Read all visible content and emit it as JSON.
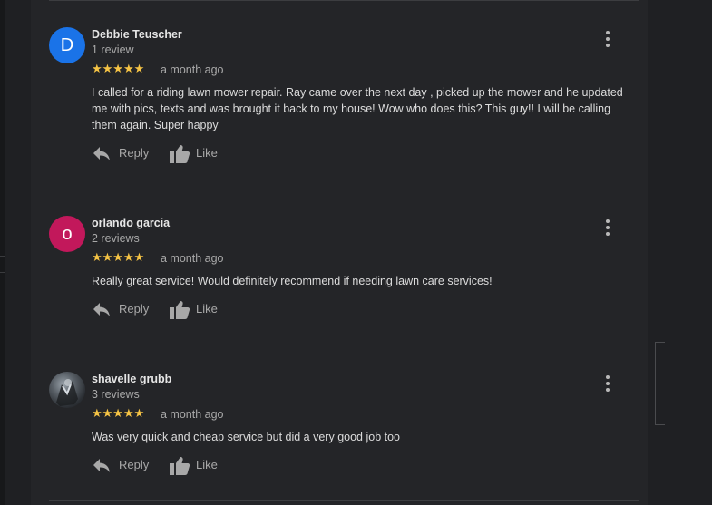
{
  "reviews": [
    {
      "avatar_letter": "D",
      "avatar_color": "#1a73e8",
      "name": "Debbie Teuscher",
      "review_count": "1 review",
      "stars": "★★★★★",
      "date": "a month ago",
      "text": "I called for a riding lawn mower repair. Ray came over the next day , picked up the mower and he updated me with pics, texts and was brought it back to my house! Wow who does this? This guy!! I will be calling them again. Super happy",
      "reply_label": "Reply",
      "like_label": "Like"
    },
    {
      "avatar_letter": "o",
      "avatar_color": "#c2185b",
      "name": "orlando garcia",
      "review_count": "2 reviews",
      "stars": "★★★★★",
      "date": "a month ago",
      "text": "Really great service! Would definitely recommend if needing lawn care services!",
      "reply_label": "Reply",
      "like_label": "Like"
    },
    {
      "avatar_letter": "",
      "avatar_color": "#3b3f44",
      "name": "shavelle grubb",
      "review_count": "3 reviews",
      "stars": "★★★★★",
      "date": "a month ago",
      "text": "Was very quick and cheap service but did a very good job too",
      "reply_label": "Reply",
      "like_label": "Like"
    }
  ],
  "icons": {
    "reply": "reply-arrow-icon",
    "like": "thumbs-up-icon",
    "more": "more-vertical-icon"
  },
  "colors": {
    "star": "#f6c445",
    "background": "#242528"
  }
}
